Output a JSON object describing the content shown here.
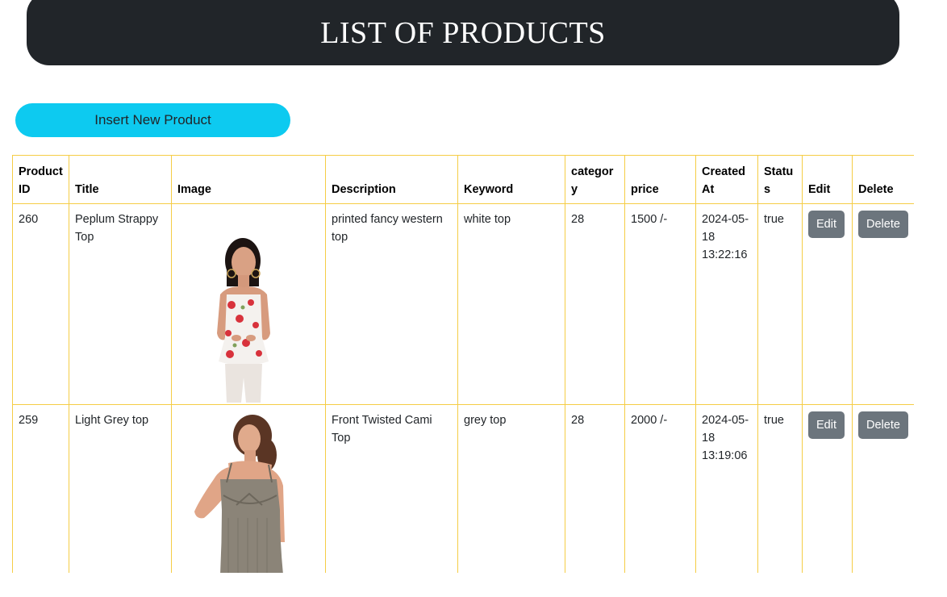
{
  "header": {
    "title": "LIST OF PRODUCTS"
  },
  "actions": {
    "insert_label": "Insert New Product"
  },
  "table": {
    "columns": [
      "Product ID",
      "Title",
      "Image",
      "Description",
      "Keyword",
      "category",
      "price",
      "Created At",
      "Status",
      "Edit",
      "Delete"
    ],
    "rows": [
      {
        "id": "260",
        "title": "Peplum Strappy Top",
        "image_icon": "product-photo-floral-top",
        "description": "printed fancy western top",
        "keyword": "white top",
        "category": "28",
        "price": "1500 /-",
        "created_at": "2024-05-18 13:22:16",
        "status": "true",
        "edit_label": "Edit",
        "delete_label": "Delete"
      },
      {
        "id": "259",
        "title": "Light Grey top",
        "image_icon": "product-photo-grey-top",
        "description": "Front Twisted Cami Top",
        "keyword": "grey top",
        "category": "28",
        "price": "2000 /-",
        "created_at": "2024-05-18 13:19:06",
        "status": "true",
        "edit_label": "Edit",
        "delete_label": "Delete"
      }
    ]
  },
  "colors": {
    "header_bg": "#212529",
    "insert_button": "#0dcaf0",
    "table_border": "#f5cd45",
    "secondary_button": "#6c757d"
  }
}
